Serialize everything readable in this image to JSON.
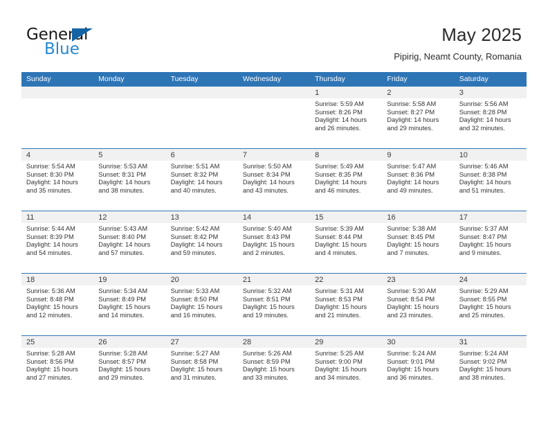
{
  "brand": {
    "name_part1": "General",
    "name_part2": "Blue",
    "triangle_color": "#1464a5",
    "blue_color": "#2389d4"
  },
  "header": {
    "title": "May 2025",
    "subtitle": "Pipirig, Neamt County, Romania"
  },
  "theme": {
    "header_blue": "#2e75b6",
    "daynum_strip": "#f1f1f1",
    "text": "#333333"
  },
  "calendar": {
    "weekday_headers": [
      "Sunday",
      "Monday",
      "Tuesday",
      "Wednesday",
      "Thursday",
      "Friday",
      "Saturday"
    ],
    "weeks": [
      [
        {
          "day": "",
          "empty": true
        },
        {
          "day": "",
          "empty": true
        },
        {
          "day": "",
          "empty": true
        },
        {
          "day": "",
          "empty": true
        },
        {
          "day": "1",
          "sunrise": "Sunrise: 5:59 AM",
          "sunset": "Sunset: 8:26 PM",
          "daylight1": "Daylight: 14 hours",
          "daylight2": "and 26 minutes."
        },
        {
          "day": "2",
          "sunrise": "Sunrise: 5:58 AM",
          "sunset": "Sunset: 8:27 PM",
          "daylight1": "Daylight: 14 hours",
          "daylight2": "and 29 minutes."
        },
        {
          "day": "3",
          "sunrise": "Sunrise: 5:56 AM",
          "sunset": "Sunset: 8:28 PM",
          "daylight1": "Daylight: 14 hours",
          "daylight2": "and 32 minutes."
        }
      ],
      [
        {
          "day": "4",
          "sunrise": "Sunrise: 5:54 AM",
          "sunset": "Sunset: 8:30 PM",
          "daylight1": "Daylight: 14 hours",
          "daylight2": "and 35 minutes."
        },
        {
          "day": "5",
          "sunrise": "Sunrise: 5:53 AM",
          "sunset": "Sunset: 8:31 PM",
          "daylight1": "Daylight: 14 hours",
          "daylight2": "and 38 minutes."
        },
        {
          "day": "6",
          "sunrise": "Sunrise: 5:51 AM",
          "sunset": "Sunset: 8:32 PM",
          "daylight1": "Daylight: 14 hours",
          "daylight2": "and 40 minutes."
        },
        {
          "day": "7",
          "sunrise": "Sunrise: 5:50 AM",
          "sunset": "Sunset: 8:34 PM",
          "daylight1": "Daylight: 14 hours",
          "daylight2": "and 43 minutes."
        },
        {
          "day": "8",
          "sunrise": "Sunrise: 5:49 AM",
          "sunset": "Sunset: 8:35 PM",
          "daylight1": "Daylight: 14 hours",
          "daylight2": "and 46 minutes."
        },
        {
          "day": "9",
          "sunrise": "Sunrise: 5:47 AM",
          "sunset": "Sunset: 8:36 PM",
          "daylight1": "Daylight: 14 hours",
          "daylight2": "and 49 minutes."
        },
        {
          "day": "10",
          "sunrise": "Sunrise: 5:46 AM",
          "sunset": "Sunset: 8:38 PM",
          "daylight1": "Daylight: 14 hours",
          "daylight2": "and 51 minutes."
        }
      ],
      [
        {
          "day": "11",
          "sunrise": "Sunrise: 5:44 AM",
          "sunset": "Sunset: 8:39 PM",
          "daylight1": "Daylight: 14 hours",
          "daylight2": "and 54 minutes."
        },
        {
          "day": "12",
          "sunrise": "Sunrise: 5:43 AM",
          "sunset": "Sunset: 8:40 PM",
          "daylight1": "Daylight: 14 hours",
          "daylight2": "and 57 minutes."
        },
        {
          "day": "13",
          "sunrise": "Sunrise: 5:42 AM",
          "sunset": "Sunset: 8:42 PM",
          "daylight1": "Daylight: 14 hours",
          "daylight2": "and 59 minutes."
        },
        {
          "day": "14",
          "sunrise": "Sunrise: 5:40 AM",
          "sunset": "Sunset: 8:43 PM",
          "daylight1": "Daylight: 15 hours",
          "daylight2": "and 2 minutes."
        },
        {
          "day": "15",
          "sunrise": "Sunrise: 5:39 AM",
          "sunset": "Sunset: 8:44 PM",
          "daylight1": "Daylight: 15 hours",
          "daylight2": "and 4 minutes."
        },
        {
          "day": "16",
          "sunrise": "Sunrise: 5:38 AM",
          "sunset": "Sunset: 8:45 PM",
          "daylight1": "Daylight: 15 hours",
          "daylight2": "and 7 minutes."
        },
        {
          "day": "17",
          "sunrise": "Sunrise: 5:37 AM",
          "sunset": "Sunset: 8:47 PM",
          "daylight1": "Daylight: 15 hours",
          "daylight2": "and 9 minutes."
        }
      ],
      [
        {
          "day": "18",
          "sunrise": "Sunrise: 5:36 AM",
          "sunset": "Sunset: 8:48 PM",
          "daylight1": "Daylight: 15 hours",
          "daylight2": "and 12 minutes."
        },
        {
          "day": "19",
          "sunrise": "Sunrise: 5:34 AM",
          "sunset": "Sunset: 8:49 PM",
          "daylight1": "Daylight: 15 hours",
          "daylight2": "and 14 minutes."
        },
        {
          "day": "20",
          "sunrise": "Sunrise: 5:33 AM",
          "sunset": "Sunset: 8:50 PM",
          "daylight1": "Daylight: 15 hours",
          "daylight2": "and 16 minutes."
        },
        {
          "day": "21",
          "sunrise": "Sunrise: 5:32 AM",
          "sunset": "Sunset: 8:51 PM",
          "daylight1": "Daylight: 15 hours",
          "daylight2": "and 19 minutes."
        },
        {
          "day": "22",
          "sunrise": "Sunrise: 5:31 AM",
          "sunset": "Sunset: 8:53 PM",
          "daylight1": "Daylight: 15 hours",
          "daylight2": "and 21 minutes."
        },
        {
          "day": "23",
          "sunrise": "Sunrise: 5:30 AM",
          "sunset": "Sunset: 8:54 PM",
          "daylight1": "Daylight: 15 hours",
          "daylight2": "and 23 minutes."
        },
        {
          "day": "24",
          "sunrise": "Sunrise: 5:29 AM",
          "sunset": "Sunset: 8:55 PM",
          "daylight1": "Daylight: 15 hours",
          "daylight2": "and 25 minutes."
        }
      ],
      [
        {
          "day": "25",
          "sunrise": "Sunrise: 5:28 AM",
          "sunset": "Sunset: 8:56 PM",
          "daylight1": "Daylight: 15 hours",
          "daylight2": "and 27 minutes."
        },
        {
          "day": "26",
          "sunrise": "Sunrise: 5:28 AM",
          "sunset": "Sunset: 8:57 PM",
          "daylight1": "Daylight: 15 hours",
          "daylight2": "and 29 minutes."
        },
        {
          "day": "27",
          "sunrise": "Sunrise: 5:27 AM",
          "sunset": "Sunset: 8:58 PM",
          "daylight1": "Daylight: 15 hours",
          "daylight2": "and 31 minutes."
        },
        {
          "day": "28",
          "sunrise": "Sunrise: 5:26 AM",
          "sunset": "Sunset: 8:59 PM",
          "daylight1": "Daylight: 15 hours",
          "daylight2": "and 33 minutes."
        },
        {
          "day": "29",
          "sunrise": "Sunrise: 5:25 AM",
          "sunset": "Sunset: 9:00 PM",
          "daylight1": "Daylight: 15 hours",
          "daylight2": "and 34 minutes."
        },
        {
          "day": "30",
          "sunrise": "Sunrise: 5:24 AM",
          "sunset": "Sunset: 9:01 PM",
          "daylight1": "Daylight: 15 hours",
          "daylight2": "and 36 minutes."
        },
        {
          "day": "31",
          "sunrise": "Sunrise: 5:24 AM",
          "sunset": "Sunset: 9:02 PM",
          "daylight1": "Daylight: 15 hours",
          "daylight2": "and 38 minutes."
        }
      ]
    ]
  }
}
